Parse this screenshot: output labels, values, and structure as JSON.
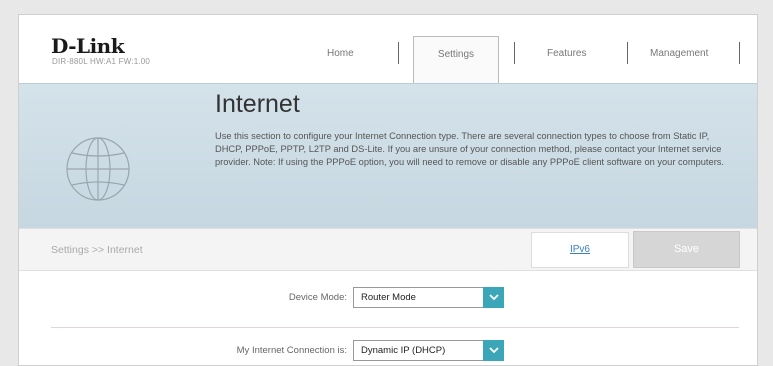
{
  "brand": {
    "logo": "D-Link",
    "model_info": "DIR-880L   HW:A1   FW:1.00"
  },
  "nav": {
    "items": [
      {
        "label": "Home"
      },
      {
        "label": "Settings",
        "active": true
      },
      {
        "label": "Features"
      },
      {
        "label": "Management"
      }
    ]
  },
  "hero": {
    "title": "Internet",
    "description": "Use this section to configure your Internet Connection type. There are several connection types to choose from Static IP, DHCP, PPPoE, PPTP, L2TP and DS-Lite. If you are unsure of your connection method, please contact your Internet service provider. Note: If using the PPPoE option, you will need to remove or disable any PPPoE client software on your computers.",
    "icon": "globe-icon"
  },
  "breadcrumb": "Settings >> Internet",
  "actions": {
    "ipv6_label": "IPv6",
    "save_label": "Save"
  },
  "form": {
    "device_mode": {
      "label": "Device Mode:",
      "value": "Router Mode"
    },
    "connection": {
      "label": "My Internet Connection is:",
      "value": "Dynamic IP (DHCP)"
    }
  },
  "colors": {
    "accent": "#3ba6b8",
    "hero_bg": "#cddde6",
    "link": "#3b7fc4"
  }
}
